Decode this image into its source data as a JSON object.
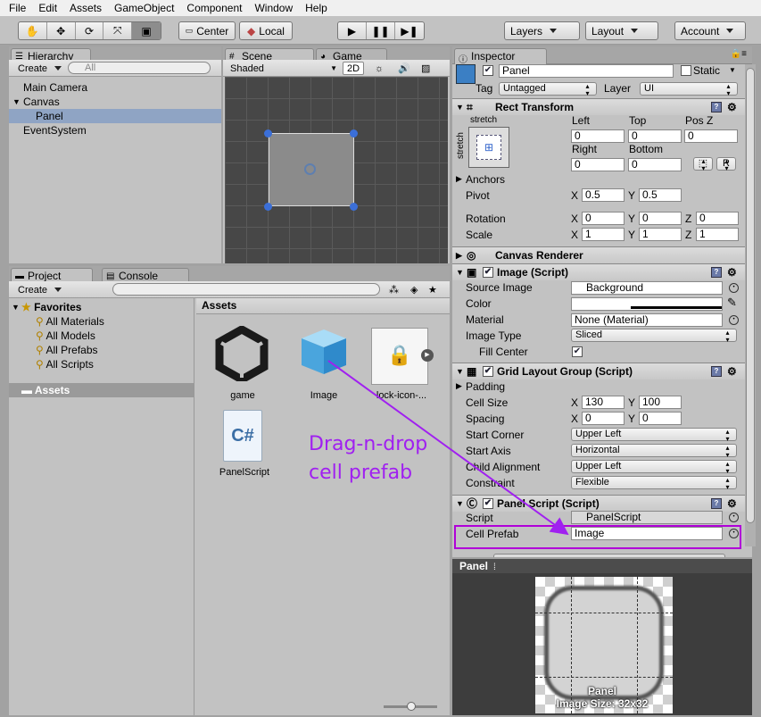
{
  "menu": [
    "File",
    "Edit",
    "Assets",
    "GameObject",
    "Component",
    "Window",
    "Help"
  ],
  "toolbar": {
    "center": "Center",
    "local": "Local",
    "layers": "Layers",
    "layout": "Layout",
    "account": "Account"
  },
  "hierarchy": {
    "tab": "Hierarchy",
    "create": "Create",
    "search_placeholder": "All",
    "items": [
      "Main Camera",
      "Canvas",
      "Panel",
      "EventSystem"
    ]
  },
  "scene": {
    "tab_scene": "Scene",
    "tab_game": "Game",
    "shaded": "Shaded",
    "mode2d": "2D"
  },
  "project": {
    "tab_project": "Project",
    "tab_console": "Console",
    "create": "Create",
    "favorites": "Favorites",
    "fav_items": [
      "All Materials",
      "All Models",
      "All Prefabs",
      "All Scripts"
    ],
    "assets_root": "Assets",
    "assets_header": "Assets",
    "assets": [
      "game",
      "Image",
      "lock-icon-...",
      "PanelScript"
    ]
  },
  "annotation": {
    "line1": "Drag-n-drop",
    "line2": "cell prefab",
    "color": "#a020f0"
  },
  "inspector": {
    "tab": "Inspector",
    "name": "Panel",
    "static": "Static",
    "tag_label": "Tag",
    "tag": "Untagged",
    "layer_label": "Layer",
    "layer": "UI",
    "rect_transform": "Rect Transform",
    "stretch": "stretch",
    "left_label": "Left",
    "top_label": "Top",
    "posz_label": "Pos Z",
    "right_label": "Right",
    "bottom_label": "Bottom",
    "left": "0",
    "top": "0",
    "posz": "0",
    "right": "0",
    "bottom": "0",
    "r_btn": "R",
    "anchors": "Anchors",
    "pivot": "Pivot",
    "pivot_x": "0.5",
    "pivot_y": "0.5",
    "rotation": "Rotation",
    "rot_x": "0",
    "rot_y": "0",
    "rot_z": "0",
    "scale": "Scale",
    "sc_x": "1",
    "sc_y": "1",
    "sc_z": "1",
    "canvas_renderer": "Canvas Renderer",
    "image_script": "Image (Script)",
    "source_image_label": "Source Image",
    "source_image": "Background",
    "color_label": "Color",
    "material_label": "Material",
    "material": "None (Material)",
    "image_type_label": "Image Type",
    "image_type": "Sliced",
    "fill_center": "Fill Center",
    "grid_layout": "Grid Layout Group (Script)",
    "padding": "Padding",
    "cell_size_label": "Cell Size",
    "cell_x": "130",
    "cell_y": "100",
    "spacing_label": "Spacing",
    "sp_x": "0",
    "sp_y": "0",
    "start_corner_label": "Start Corner",
    "start_corner": "Upper Left",
    "start_axis_label": "Start Axis",
    "start_axis": "Horizontal",
    "child_align_label": "Child Alignment",
    "child_align": "Upper Left",
    "constraint_label": "Constraint",
    "constraint": "Flexible",
    "panel_script": "Panel Script (Script)",
    "script_label": "Script",
    "script": "PanelScript",
    "cell_prefab_label": "Cell Prefab",
    "cell_prefab": "Image",
    "x": "X",
    "y": "Y",
    "z": "Z"
  },
  "preview": {
    "title": "Panel",
    "caption1": "Panel",
    "caption2": "Image Size: 32x32"
  }
}
